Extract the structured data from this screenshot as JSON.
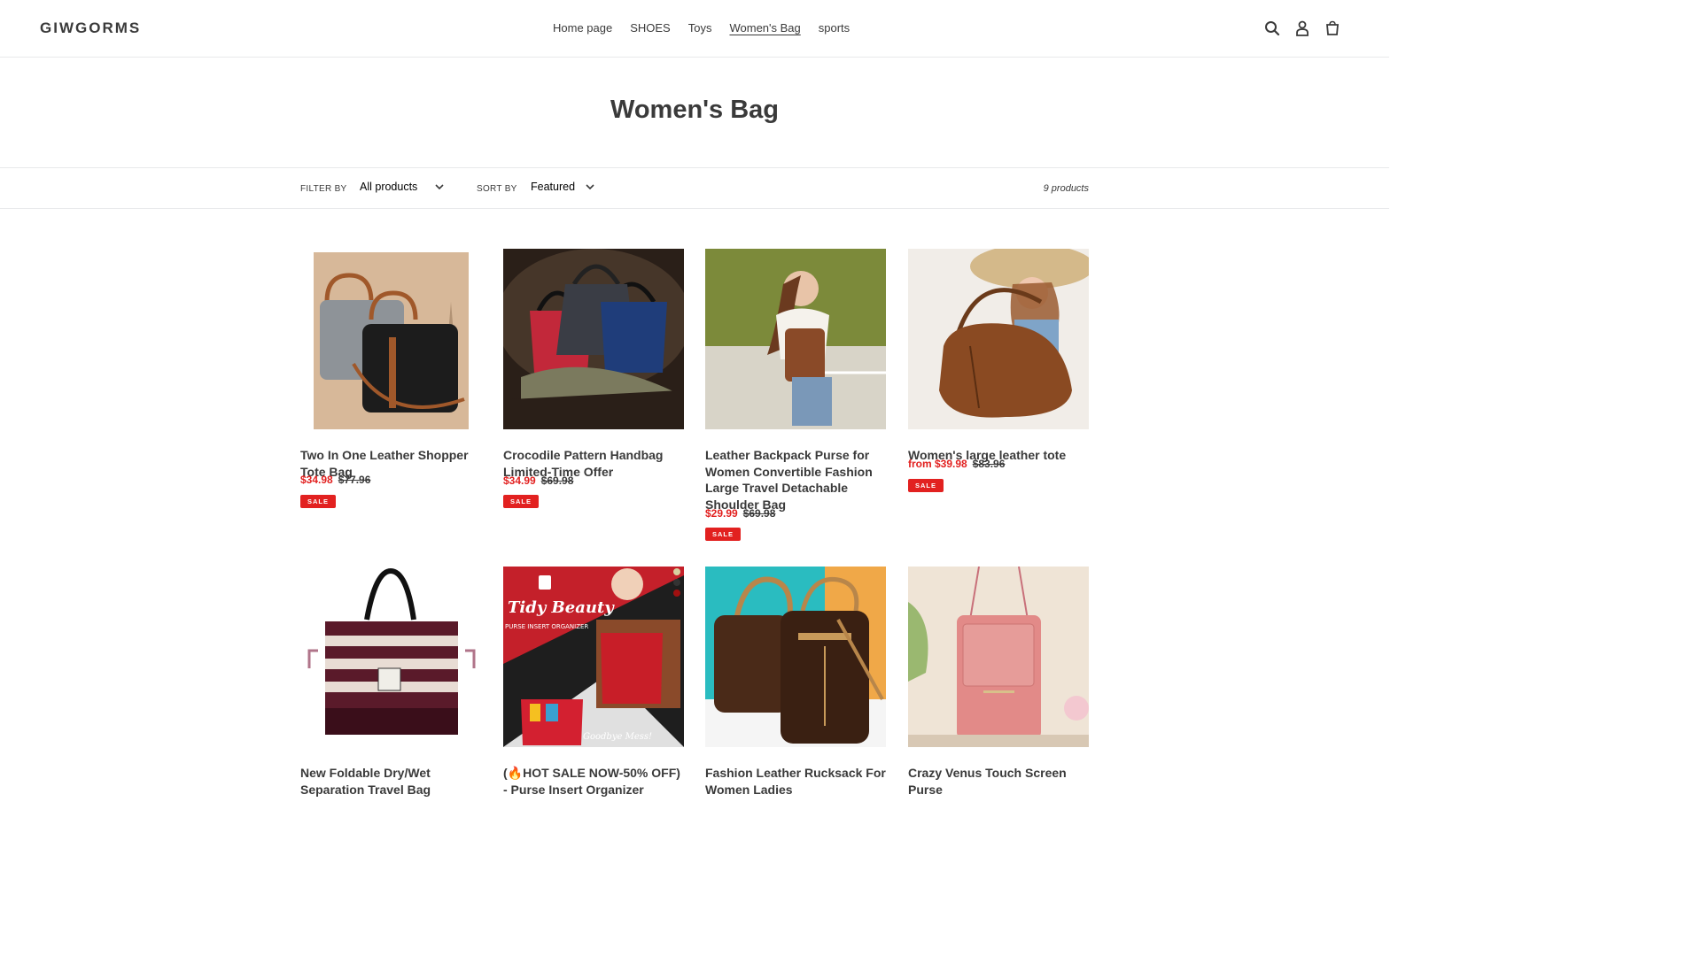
{
  "header": {
    "logo": "GIWGORMS",
    "nav": [
      "Home page",
      "SHOES",
      "Toys",
      "Women's Bag",
      "sports"
    ],
    "active_nav": "Women's Bag",
    "icons": [
      "search-icon",
      "account-icon",
      "cart-icon"
    ]
  },
  "collection": {
    "title": "Women's Bag",
    "filter_label": "FILTER BY",
    "filter_value": "All products",
    "sort_label": "SORT BY",
    "sort_value": "Featured",
    "count": "9 products"
  },
  "products": [
    {
      "name": "Two In One Leather Shopper Tote Bag",
      "price": "$34.98",
      "compare": "$77.96",
      "badge": "SALE"
    },
    {
      "name": "Crocodile Pattern Handbag Limited-Time Offer",
      "price": "$34.99",
      "compare": "$69.98",
      "badge": "SALE"
    },
    {
      "name": "Leather Backpack Purse for Women Convertible Fashion Large Travel Detachable Shoulder Bag",
      "price": "$29.99",
      "compare": "$69.98",
      "badge": "SALE"
    },
    {
      "name": "Women's large leather tote",
      "price": "from $39.98",
      "compare": "$83.96",
      "badge": "SALE"
    },
    {
      "name": "New Foldable Dry/Wet Separation Travel Bag"
    },
    {
      "name": "(🔥HOT SALE NOW-50% OFF) - Purse Insert Organizer"
    },
    {
      "name": "Fashion Leather Rucksack For Women Ladies"
    },
    {
      "name": "Crazy Venus Touch Screen Purse"
    }
  ],
  "image_text": {
    "brand": "Tidy Beauty",
    "subtitle": "PURSE INSERT ORGANIZER",
    "slogan": "Goodbye Mess!"
  },
  "colors": {
    "sale": "#e22120",
    "text": "#3a3a3a",
    "border": "#e8e9eb"
  }
}
